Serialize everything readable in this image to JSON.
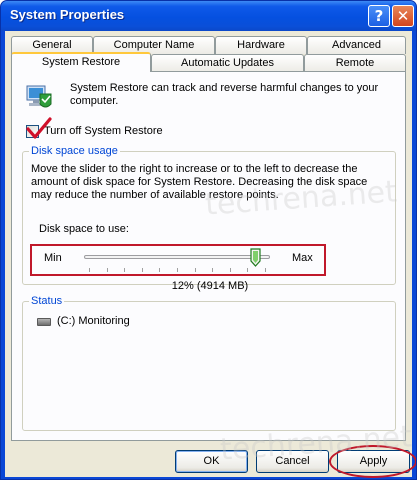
{
  "window": {
    "title": "System Properties",
    "help_label": "?",
    "close_label": "✕"
  },
  "tabs_row1": [
    "General",
    "Computer Name",
    "Hardware",
    "Advanced"
  ],
  "tabs_row2": [
    "System Restore",
    "Automatic Updates",
    "Remote"
  ],
  "active_tab": "System Restore",
  "intro": {
    "icon": "system-restore-shield-icon",
    "text": "System Restore can track and reverse harmful changes to your computer."
  },
  "turn_off": {
    "label": "Turn off System Restore",
    "checked": true
  },
  "disk_usage": {
    "title": "Disk space usage",
    "description": "Move the slider to the right to increase or to the left to decrease the amount of disk space for System Restore. Decreasing the disk space may reduce the number of available restore points.",
    "slider_label": "Disk space to use:",
    "min_label": "Min",
    "max_label": "Max",
    "value_fraction": 0.92,
    "value_text": "12% (4914 MB)"
  },
  "status": {
    "title": "Status",
    "drive_icon": "drive-icon",
    "drive_text": "(C:) Monitoring"
  },
  "watermark": "techrena.net",
  "buttons": {
    "ok": "OK",
    "cancel": "Cancel",
    "apply": "Apply"
  },
  "colors": {
    "title_bar": "#0550e0",
    "group_title": "#0046d5",
    "annotation": "#c0182a"
  }
}
